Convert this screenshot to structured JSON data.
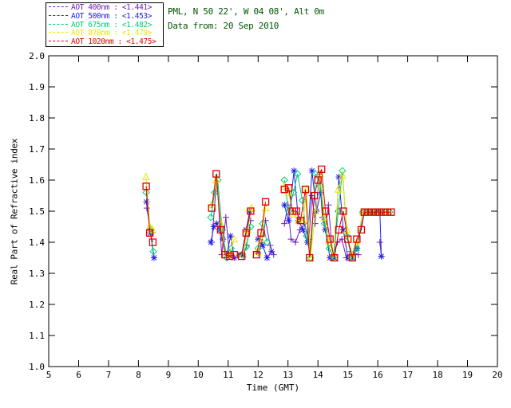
{
  "header": {
    "line1": "PML, N 50 22', W 04 08', Alt 0m",
    "line2": "Data from: 20 Sep 2010",
    "color": "#005500"
  },
  "legend": {
    "items": [
      {
        "text": "AOT  400nm : <1.441>",
        "color": "#6E1FB5"
      },
      {
        "text": "AOT  500nm : <1.453>",
        "color": "#2222E6"
      },
      {
        "text": "AOT  675nm : <1.482>",
        "color": "#00CC7A"
      },
      {
        "text": "AOT  870nm : <1.479>",
        "color": "#E8E800"
      },
      {
        "text": "AOT 1020nm : <1.475>",
        "color": "#E00000"
      }
    ]
  },
  "chart_data": {
    "type": "line",
    "title": "",
    "xlabel": "Time (GMT)",
    "ylabel": "Real Part of Refractive index",
    "xlim": [
      5,
      20
    ],
    "ylim": [
      1.0,
      2.0
    ],
    "xticks": [
      "5",
      "6",
      "7",
      "8",
      "9",
      "10",
      "11",
      "12",
      "13",
      "14",
      "15",
      "16",
      "17",
      "18",
      "19",
      "20"
    ],
    "ytick_values": [
      1.0,
      1.1,
      1.2,
      1.3,
      1.4,
      1.5,
      1.6,
      1.7,
      1.8,
      1.9,
      2.0
    ],
    "yticks": [
      "1.0",
      "1.1",
      "1.2",
      "1.3",
      "1.4",
      "1.5",
      "1.6",
      "1.7",
      "1.8",
      "1.9",
      "2.0"
    ],
    "grid": false,
    "legend_position": "outside-top-left",
    "series": [
      {
        "name": "AOT 400nm",
        "mean": "<1.441>",
        "color": "#6E1FB5",
        "marker": "plus",
        "segments": [
          [
            [
              8.28,
              1.51
            ],
            [
              8.4,
              1.44
            ],
            [
              8.46,
              1.43
            ]
          ],
          [
            [
              10.45,
              1.4
            ],
            [
              10.62,
              1.61
            ],
            [
              10.78,
              1.36
            ],
            [
              10.92,
              1.48
            ],
            [
              11.05,
              1.355
            ]
          ],
          [
            [
              11.5,
              1.355
            ],
            [
              11.62,
              1.39
            ],
            [
              11.75,
              1.47
            ]
          ],
          [
            [
              12.0,
              1.365
            ],
            [
              12.12,
              1.4
            ],
            [
              12.25,
              1.47
            ],
            [
              12.4,
              1.39
            ],
            [
              12.52,
              1.36
            ]
          ],
          [
            [
              12.88,
              1.46
            ],
            [
              13.0,
              1.52
            ],
            [
              13.1,
              1.41
            ],
            [
              13.25,
              1.4
            ],
            [
              13.4,
              1.44
            ],
            [
              13.55,
              1.46
            ],
            [
              13.7,
              1.41
            ],
            [
              13.8,
              1.55
            ],
            [
              13.9,
              1.46
            ],
            [
              14.05,
              1.62
            ],
            [
              14.15,
              1.48
            ],
            [
              14.25,
              1.44
            ],
            [
              14.35,
              1.52
            ],
            [
              14.5,
              1.35
            ],
            [
              14.65,
              1.4
            ],
            [
              14.8,
              1.41
            ],
            [
              14.95,
              1.35
            ],
            [
              15.1,
              1.37
            ],
            [
              15.35,
              1.36
            ]
          ],
          [
            [
              16.07,
              1.4
            ],
            [
              16.12,
              1.355
            ]
          ]
        ]
      },
      {
        "name": "AOT 500nm",
        "mean": "<1.453>",
        "color": "#2222E6",
        "marker": "asterisk",
        "segments": [
          [
            [
              8.27,
              1.53
            ],
            [
              8.4,
              1.43
            ],
            [
              8.52,
              1.35
            ]
          ],
          [
            [
              10.42,
              1.4
            ],
            [
              10.52,
              1.45
            ],
            [
              10.62,
              1.46
            ],
            [
              10.72,
              1.44
            ],
            [
              10.82,
              1.41
            ],
            [
              10.95,
              1.36
            ],
            [
              11.08,
              1.42
            ],
            [
              11.2,
              1.35
            ]
          ],
          [
            [
              11.45,
              1.36
            ],
            [
              11.6,
              1.44
            ],
            [
              11.72,
              1.5
            ]
          ],
          [
            [
              12.0,
              1.41
            ],
            [
              12.15,
              1.39
            ],
            [
              12.3,
              1.35
            ],
            [
              12.45,
              1.37
            ]
          ],
          [
            [
              12.88,
              1.52
            ],
            [
              13.02,
              1.47
            ],
            [
              13.2,
              1.63
            ],
            [
              13.35,
              1.47
            ],
            [
              13.5,
              1.44
            ],
            [
              13.65,
              1.4
            ],
            [
              13.8,
              1.63
            ],
            [
              13.95,
              1.5
            ],
            [
              14.1,
              1.56
            ],
            [
              14.25,
              1.44
            ],
            [
              14.4,
              1.35
            ],
            [
              14.55,
              1.35
            ],
            [
              14.7,
              1.61
            ],
            [
              14.85,
              1.44
            ],
            [
              15.0,
              1.35
            ],
            [
              15.15,
              1.35
            ],
            [
              15.3,
              1.38
            ],
            [
              15.55,
              1.497
            ],
            [
              15.75,
              1.497
            ],
            [
              15.95,
              1.497
            ],
            [
              16.07,
              1.497
            ],
            [
              16.12,
              1.355
            ]
          ]
        ]
      },
      {
        "name": "AOT 675nm",
        "mean": "<1.482>",
        "color": "#00CC7A",
        "marker": "diamond",
        "segments": [
          [
            [
              8.26,
              1.56
            ],
            [
              8.4,
              1.44
            ],
            [
              8.5,
              1.37
            ]
          ],
          [
            [
              10.42,
              1.48
            ],
            [
              10.55,
              1.56
            ],
            [
              10.65,
              1.6
            ],
            [
              10.8,
              1.44
            ],
            [
              10.95,
              1.35
            ],
            [
              11.1,
              1.38
            ]
          ],
          [
            [
              11.45,
              1.36
            ],
            [
              11.6,
              1.385
            ],
            [
              11.75,
              1.45
            ]
          ],
          [
            [
              12.0,
              1.38
            ],
            [
              12.15,
              1.46
            ],
            [
              12.3,
              1.4
            ]
          ],
          [
            [
              12.88,
              1.6
            ],
            [
              13.02,
              1.5
            ],
            [
              13.18,
              1.56
            ],
            [
              13.32,
              1.62
            ],
            [
              13.48,
              1.535
            ],
            [
              13.62,
              1.42
            ],
            [
              13.75,
              1.35
            ],
            [
              13.92,
              1.62
            ],
            [
              14.08,
              1.58
            ],
            [
              14.22,
              1.46
            ],
            [
              14.38,
              1.38
            ],
            [
              14.52,
              1.35
            ],
            [
              14.68,
              1.5
            ],
            [
              14.82,
              1.63
            ],
            [
              14.97,
              1.42
            ],
            [
              15.12,
              1.35
            ],
            [
              15.3,
              1.38
            ],
            [
              15.5,
              1.497
            ],
            [
              15.65,
              1.497
            ],
            [
              15.8,
              1.497
            ],
            [
              15.95,
              1.497
            ],
            [
              16.1,
              1.497
            ],
            [
              16.25,
              1.497
            ],
            [
              16.4,
              1.497
            ]
          ]
        ]
      },
      {
        "name": "AOT 870nm",
        "mean": "<1.479>",
        "color": "#E8E800",
        "marker": "triangle",
        "segments": [
          [
            [
              8.25,
              1.61
            ],
            [
              8.38,
              1.45
            ],
            [
              8.47,
              1.44
            ]
          ],
          [
            [
              10.45,
              1.52
            ],
            [
              10.6,
              1.6
            ],
            [
              10.75,
              1.46
            ],
            [
              10.9,
              1.36
            ],
            [
              11.05,
              1.36
            ],
            [
              11.2,
              1.41
            ]
          ],
          [
            [
              11.5,
              1.36
            ],
            [
              11.65,
              1.44
            ],
            [
              11.78,
              1.51
            ]
          ],
          [
            [
              11.98,
              1.37
            ],
            [
              12.1,
              1.41
            ],
            [
              12.25,
              1.51
            ]
          ],
          [
            [
              12.88,
              1.58
            ],
            [
              13.02,
              1.56
            ],
            [
              13.18,
              1.49
            ],
            [
              13.35,
              1.47
            ],
            [
              13.5,
              1.47
            ],
            [
              13.62,
              1.57
            ],
            [
              13.75,
              1.35
            ],
            [
              13.92,
              1.5
            ],
            [
              14.08,
              1.62
            ],
            [
              14.22,
              1.48
            ],
            [
              14.38,
              1.4
            ],
            [
              14.52,
              1.36
            ],
            [
              14.68,
              1.57
            ],
            [
              14.82,
              1.615
            ],
            [
              14.97,
              1.44
            ],
            [
              15.12,
              1.36
            ],
            [
              15.3,
              1.4
            ],
            [
              15.5,
              1.497
            ],
            [
              15.7,
              1.497
            ],
            [
              15.9,
              1.497
            ],
            [
              16.1,
              1.497
            ],
            [
              16.3,
              1.497
            ]
          ]
        ]
      },
      {
        "name": "AOT 1020nm",
        "mean": "<1.475>",
        "color": "#E00000",
        "marker": "square",
        "segments": [
          [
            [
              8.26,
              1.58
            ],
            [
              8.38,
              1.43
            ],
            [
              8.48,
              1.4
            ]
          ],
          [
            [
              10.45,
              1.51
            ],
            [
              10.6,
              1.62
            ],
            [
              10.75,
              1.44
            ],
            [
              10.9,
              1.36
            ],
            [
              11.05,
              1.355
            ],
            [
              11.2,
              1.36
            ]
          ],
          [
            [
              11.45,
              1.355
            ],
            [
              11.6,
              1.43
            ],
            [
              11.75,
              1.5
            ]
          ],
          [
            [
              11.95,
              1.36
            ],
            [
              12.1,
              1.43
            ],
            [
              12.25,
              1.53
            ]
          ],
          [
            [
              12.88,
              1.57
            ],
            [
              13.02,
              1.575
            ],
            [
              13.15,
              1.5
            ],
            [
              13.28,
              1.5
            ],
            [
              13.42,
              1.47
            ],
            [
              13.58,
              1.57
            ],
            [
              13.72,
              1.35
            ],
            [
              13.88,
              1.55
            ],
            [
              14.0,
              1.6
            ],
            [
              14.12,
              1.635
            ],
            [
              14.25,
              1.5
            ],
            [
              14.4,
              1.41
            ],
            [
              14.55,
              1.35
            ],
            [
              14.7,
              1.44
            ],
            [
              14.85,
              1.5
            ],
            [
              15.0,
              1.41
            ],
            [
              15.15,
              1.35
            ],
            [
              15.3,
              1.41
            ],
            [
              15.45,
              1.44
            ],
            [
              15.55,
              1.497
            ],
            [
              15.68,
              1.497
            ],
            [
              15.8,
              1.497
            ],
            [
              15.93,
              1.497
            ],
            [
              16.06,
              1.497
            ],
            [
              16.19,
              1.497
            ],
            [
              16.32,
              1.497
            ],
            [
              16.45,
              1.497
            ]
          ]
        ]
      }
    ]
  }
}
